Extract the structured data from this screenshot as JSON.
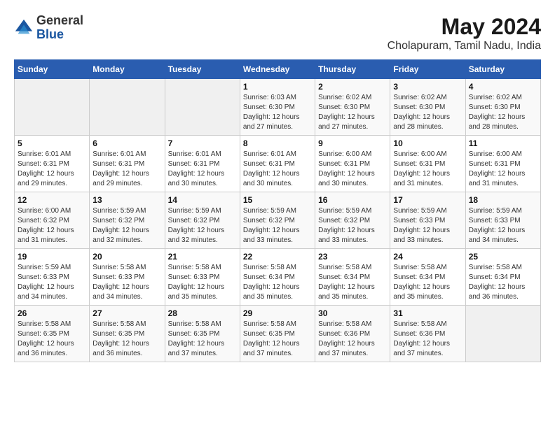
{
  "header": {
    "logo_line1": "General",
    "logo_line2": "Blue",
    "title": "May 2024",
    "subtitle": "Cholapuram, Tamil Nadu, India"
  },
  "weekdays": [
    "Sunday",
    "Monday",
    "Tuesday",
    "Wednesday",
    "Thursday",
    "Friday",
    "Saturday"
  ],
  "weeks": [
    [
      {
        "day": "",
        "info": ""
      },
      {
        "day": "",
        "info": ""
      },
      {
        "day": "",
        "info": ""
      },
      {
        "day": "1",
        "info": "Sunrise: 6:03 AM\nSunset: 6:30 PM\nDaylight: 12 hours\nand 27 minutes."
      },
      {
        "day": "2",
        "info": "Sunrise: 6:02 AM\nSunset: 6:30 PM\nDaylight: 12 hours\nand 27 minutes."
      },
      {
        "day": "3",
        "info": "Sunrise: 6:02 AM\nSunset: 6:30 PM\nDaylight: 12 hours\nand 28 minutes."
      },
      {
        "day": "4",
        "info": "Sunrise: 6:02 AM\nSunset: 6:30 PM\nDaylight: 12 hours\nand 28 minutes."
      }
    ],
    [
      {
        "day": "5",
        "info": "Sunrise: 6:01 AM\nSunset: 6:31 PM\nDaylight: 12 hours\nand 29 minutes."
      },
      {
        "day": "6",
        "info": "Sunrise: 6:01 AM\nSunset: 6:31 PM\nDaylight: 12 hours\nand 29 minutes."
      },
      {
        "day": "7",
        "info": "Sunrise: 6:01 AM\nSunset: 6:31 PM\nDaylight: 12 hours\nand 30 minutes."
      },
      {
        "day": "8",
        "info": "Sunrise: 6:01 AM\nSunset: 6:31 PM\nDaylight: 12 hours\nand 30 minutes."
      },
      {
        "day": "9",
        "info": "Sunrise: 6:00 AM\nSunset: 6:31 PM\nDaylight: 12 hours\nand 30 minutes."
      },
      {
        "day": "10",
        "info": "Sunrise: 6:00 AM\nSunset: 6:31 PM\nDaylight: 12 hours\nand 31 minutes."
      },
      {
        "day": "11",
        "info": "Sunrise: 6:00 AM\nSunset: 6:31 PM\nDaylight: 12 hours\nand 31 minutes."
      }
    ],
    [
      {
        "day": "12",
        "info": "Sunrise: 6:00 AM\nSunset: 6:32 PM\nDaylight: 12 hours\nand 31 minutes."
      },
      {
        "day": "13",
        "info": "Sunrise: 5:59 AM\nSunset: 6:32 PM\nDaylight: 12 hours\nand 32 minutes."
      },
      {
        "day": "14",
        "info": "Sunrise: 5:59 AM\nSunset: 6:32 PM\nDaylight: 12 hours\nand 32 minutes."
      },
      {
        "day": "15",
        "info": "Sunrise: 5:59 AM\nSunset: 6:32 PM\nDaylight: 12 hours\nand 33 minutes."
      },
      {
        "day": "16",
        "info": "Sunrise: 5:59 AM\nSunset: 6:32 PM\nDaylight: 12 hours\nand 33 minutes."
      },
      {
        "day": "17",
        "info": "Sunrise: 5:59 AM\nSunset: 6:33 PM\nDaylight: 12 hours\nand 33 minutes."
      },
      {
        "day": "18",
        "info": "Sunrise: 5:59 AM\nSunset: 6:33 PM\nDaylight: 12 hours\nand 34 minutes."
      }
    ],
    [
      {
        "day": "19",
        "info": "Sunrise: 5:59 AM\nSunset: 6:33 PM\nDaylight: 12 hours\nand 34 minutes."
      },
      {
        "day": "20",
        "info": "Sunrise: 5:58 AM\nSunset: 6:33 PM\nDaylight: 12 hours\nand 34 minutes."
      },
      {
        "day": "21",
        "info": "Sunrise: 5:58 AM\nSunset: 6:33 PM\nDaylight: 12 hours\nand 35 minutes."
      },
      {
        "day": "22",
        "info": "Sunrise: 5:58 AM\nSunset: 6:34 PM\nDaylight: 12 hours\nand 35 minutes."
      },
      {
        "day": "23",
        "info": "Sunrise: 5:58 AM\nSunset: 6:34 PM\nDaylight: 12 hours\nand 35 minutes."
      },
      {
        "day": "24",
        "info": "Sunrise: 5:58 AM\nSunset: 6:34 PM\nDaylight: 12 hours\nand 35 minutes."
      },
      {
        "day": "25",
        "info": "Sunrise: 5:58 AM\nSunset: 6:34 PM\nDaylight: 12 hours\nand 36 minutes."
      }
    ],
    [
      {
        "day": "26",
        "info": "Sunrise: 5:58 AM\nSunset: 6:35 PM\nDaylight: 12 hours\nand 36 minutes."
      },
      {
        "day": "27",
        "info": "Sunrise: 5:58 AM\nSunset: 6:35 PM\nDaylight: 12 hours\nand 36 minutes."
      },
      {
        "day": "28",
        "info": "Sunrise: 5:58 AM\nSunset: 6:35 PM\nDaylight: 12 hours\nand 37 minutes."
      },
      {
        "day": "29",
        "info": "Sunrise: 5:58 AM\nSunset: 6:35 PM\nDaylight: 12 hours\nand 37 minutes."
      },
      {
        "day": "30",
        "info": "Sunrise: 5:58 AM\nSunset: 6:36 PM\nDaylight: 12 hours\nand 37 minutes."
      },
      {
        "day": "31",
        "info": "Sunrise: 5:58 AM\nSunset: 6:36 PM\nDaylight: 12 hours\nand 37 minutes."
      },
      {
        "day": "",
        "info": ""
      }
    ]
  ]
}
